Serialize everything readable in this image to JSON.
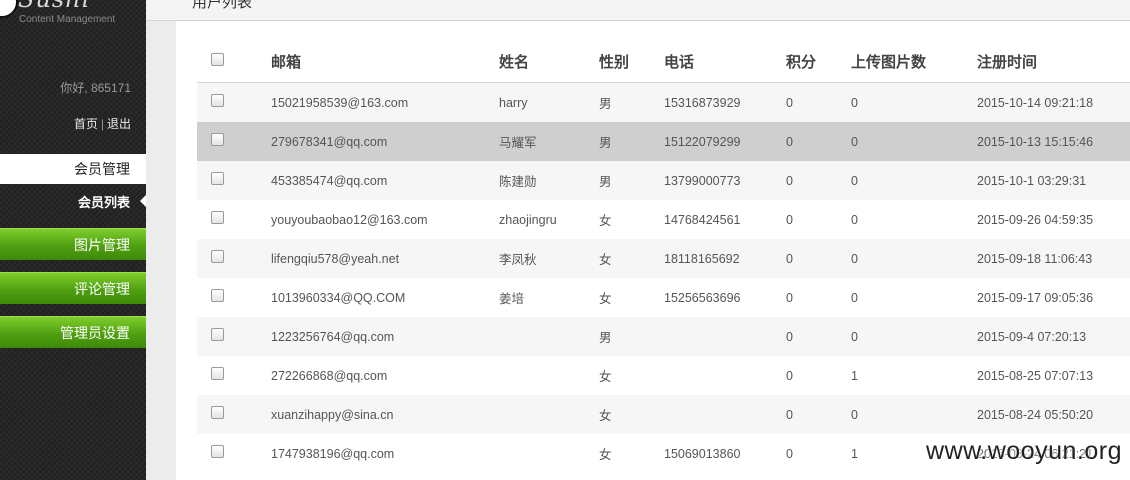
{
  "app": {
    "logo_title": "Sushi",
    "logo_subtitle": "Content Management"
  },
  "sidebar": {
    "greeting": "你好, 865171",
    "home_link": "首页",
    "link_separator": "|",
    "logout_link": "退出",
    "section_title": "会员管理",
    "active_item": "会员列表",
    "items": [
      {
        "label": "图片管理"
      },
      {
        "label": "评论管理"
      },
      {
        "label": "管理员设置"
      }
    ]
  },
  "page": {
    "title": "用户列表"
  },
  "table": {
    "columns": [
      "邮箱",
      "姓名",
      "性别",
      "电话",
      "积分",
      "上传图片数",
      "注册时间"
    ],
    "rows": [
      {
        "email": "15021958539@163.com",
        "name": "harry",
        "sex": "男",
        "phone": "15316873929",
        "points": "0",
        "uploads": "0",
        "registered": "2015-10-14 09:21:18"
      },
      {
        "email": "279678341@qq.com",
        "name": "马耀军",
        "sex": "男",
        "phone": "15122079299",
        "points": "0",
        "uploads": "0",
        "registered": "2015-10-13 15:15:46"
      },
      {
        "email": "453385474@qq.com",
        "name": "陈建勋",
        "sex": "男",
        "phone": "13799000773",
        "points": "0",
        "uploads": "0",
        "registered": "2015-10-1 03:29:31"
      },
      {
        "email": "youyoubaobao12@163.com",
        "name": "zhaojingru",
        "sex": "女",
        "phone": "14768424561",
        "points": "0",
        "uploads": "0",
        "registered": "2015-09-26 04:59:35"
      },
      {
        "email": "lifengqiu578@yeah.net",
        "name": "李凤秋",
        "sex": "女",
        "phone": "18118165692",
        "points": "0",
        "uploads": "0",
        "registered": "2015-09-18 11:06:43"
      },
      {
        "email": "1013960334@QQ.COM",
        "name": "姜培",
        "sex": "女",
        "phone": "15256563696",
        "points": "0",
        "uploads": "0",
        "registered": "2015-09-17 09:05:36"
      },
      {
        "email": "1223256764@qq.com",
        "name": "",
        "sex": "男",
        "phone": "",
        "points": "0",
        "uploads": "0",
        "registered": "2015-09-4 07:20:13"
      },
      {
        "email": "272266868@qq.com",
        "name": "",
        "sex": "女",
        "phone": "",
        "points": "0",
        "uploads": "1",
        "registered": "2015-08-25 07:07:13"
      },
      {
        "email": "xuanzihappy@sina.cn",
        "name": "",
        "sex": "女",
        "phone": "",
        "points": "0",
        "uploads": "0",
        "registered": "2015-08-24 05:50:20"
      },
      {
        "email": "1747938196@qq.com",
        "name": "",
        "sex": "女",
        "phone": "15069013860",
        "points": "0",
        "uploads": "1",
        "registered": "2015-08-24 06:21:21"
      }
    ],
    "selected_row": 1
  },
  "watermark": "www.wooyun.org",
  "colors": {
    "sidebar_bg": "#262626",
    "nav_green": "#5aaa17",
    "selected_row": "#cfcfcf",
    "stripe_row": "#f6f6f6"
  }
}
